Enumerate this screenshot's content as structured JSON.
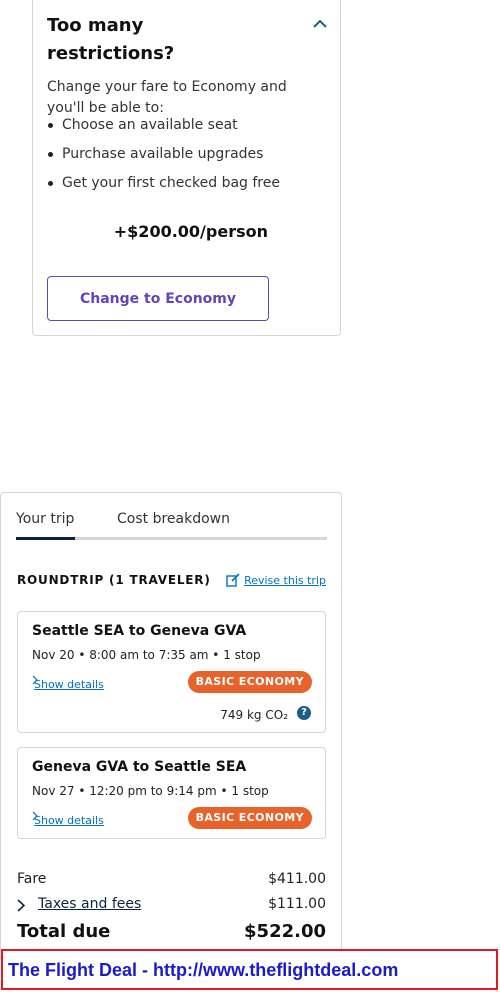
{
  "upsell": {
    "title": "Too many restrictions?",
    "intro": "Change your fare to Economy and you'll be able to:",
    "benefits": [
      "Choose an available seat",
      "Purchase available upgrades",
      "Get your first checked bag free"
    ],
    "price": "+$200.00/person",
    "button_label": "Change to Economy"
  },
  "summary": {
    "tabs": [
      "Your trip",
      "Cost breakdown"
    ],
    "trip_label": "ROUNDTRIP (1 TRAVELER)",
    "revise_label": "Revise this trip",
    "segments": [
      {
        "route": "Seattle SEA to Geneva GVA",
        "time": "Nov 20 • 8:00 am to 7:35 am • 1 stop",
        "details_label": "Show details",
        "fare_class": "BASIC ECONOMY",
        "co2": "749 kg CO₂"
      },
      {
        "route": "Geneva GVA to Seattle SEA",
        "time": "Nov 27 • 12:20 pm to 9:14 pm • 1 stop",
        "details_label": "Show details",
        "fare_class": "BASIC ECONOMY"
      }
    ],
    "fare_label": "Fare",
    "fare_value": "$411.00",
    "taxes_label": "Taxes and fees",
    "taxes_value": "$111.00",
    "total_label": "Total due",
    "total_value": "$522.00"
  },
  "banner": {
    "text": "The Flight Deal - http://www.theflightdeal.com"
  },
  "colors": {
    "accent": "#6244bb",
    "badge": "#e8622b",
    "link": "#0071c5",
    "navy": "#0c2340",
    "banner_border": "#e01b24",
    "banner_text": "#1a1ad1"
  }
}
